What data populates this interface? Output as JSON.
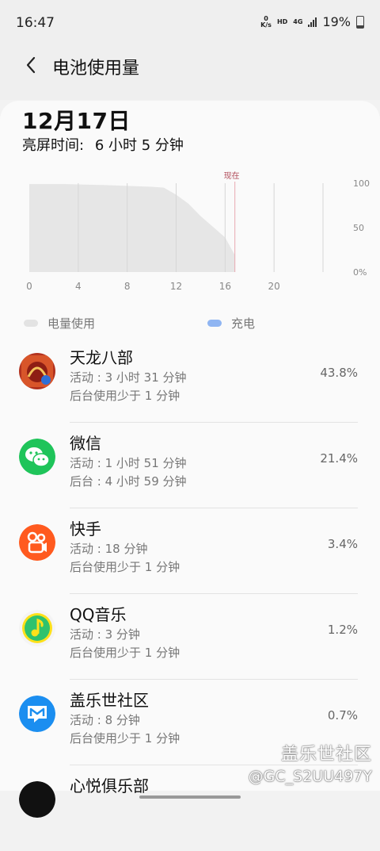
{
  "status_bar": {
    "time": "16:47",
    "net_speed_value": "0",
    "net_speed_unit": "K/s",
    "hd_label": "HD",
    "network_label": "4G",
    "battery_percent": "19%"
  },
  "app_bar": {
    "title": "电池使用量"
  },
  "summary": {
    "date": "12月17日",
    "screen_time_label": "亮屏时间:",
    "screen_time_value": "6 小时 5 分钟"
  },
  "chart_data": {
    "type": "area",
    "x_ticks": [
      "0",
      "4",
      "8",
      "12",
      "16",
      "20"
    ],
    "y_ticks": [
      "100",
      "50",
      "0%"
    ],
    "xlim": [
      0,
      24
    ],
    "ylim": [
      0,
      100
    ],
    "now_label": "现在",
    "now_x": 16.8,
    "series": [
      {
        "x": [
          0,
          3,
          6,
          8,
          10,
          11,
          12,
          13,
          14,
          15,
          16,
          16.8
        ],
        "values": [
          99,
          99,
          98,
          97,
          96,
          95,
          87,
          77,
          63,
          51,
          39,
          19
        ]
      }
    ],
    "colors": {
      "area": "#e6e6e6",
      "now_line": "#e8a7b0",
      "grid": "#d6d6d6"
    }
  },
  "legend": {
    "usage_label": "电量使用",
    "usage_color": "#e3e3e3",
    "charge_label": "充电",
    "charge_color": "#8fb5f2"
  },
  "apps": [
    {
      "name": "天龙八部",
      "line1": "活动 : 3 小时 31 分钟",
      "line2": "后台使用少于 1 分钟",
      "percent": "43.8%",
      "icon": "tianlong-game-icon"
    },
    {
      "name": "微信",
      "line1": "活动 : 1 小时 51 分钟",
      "line2": "后台 : 4 小时 59 分钟",
      "percent": "21.4%",
      "icon": "wechat-icon"
    },
    {
      "name": "快手",
      "line1": "活动 : 18 分钟",
      "line2": "后台使用少于 1 分钟",
      "percent": "3.4%",
      "icon": "kuaishou-icon"
    },
    {
      "name": "QQ音乐",
      "line1": "活动 : 3 分钟",
      "line2": "后台使用少于 1 分钟",
      "percent": "1.2%",
      "icon": "qq-music-icon"
    },
    {
      "name": "盖乐世社区",
      "line1": "活动 : 8 分钟",
      "line2": "后台使用少于 1 分钟",
      "percent": "0.7%",
      "icon": "galaxy-community-icon"
    },
    {
      "name": "心悦俱乐部",
      "line1": "",
      "line2": "",
      "percent": "",
      "icon": "xinyue-club-icon"
    }
  ],
  "watermark": {
    "site": "盖乐世社区",
    "user": "@GC_S2UU497Y"
  }
}
